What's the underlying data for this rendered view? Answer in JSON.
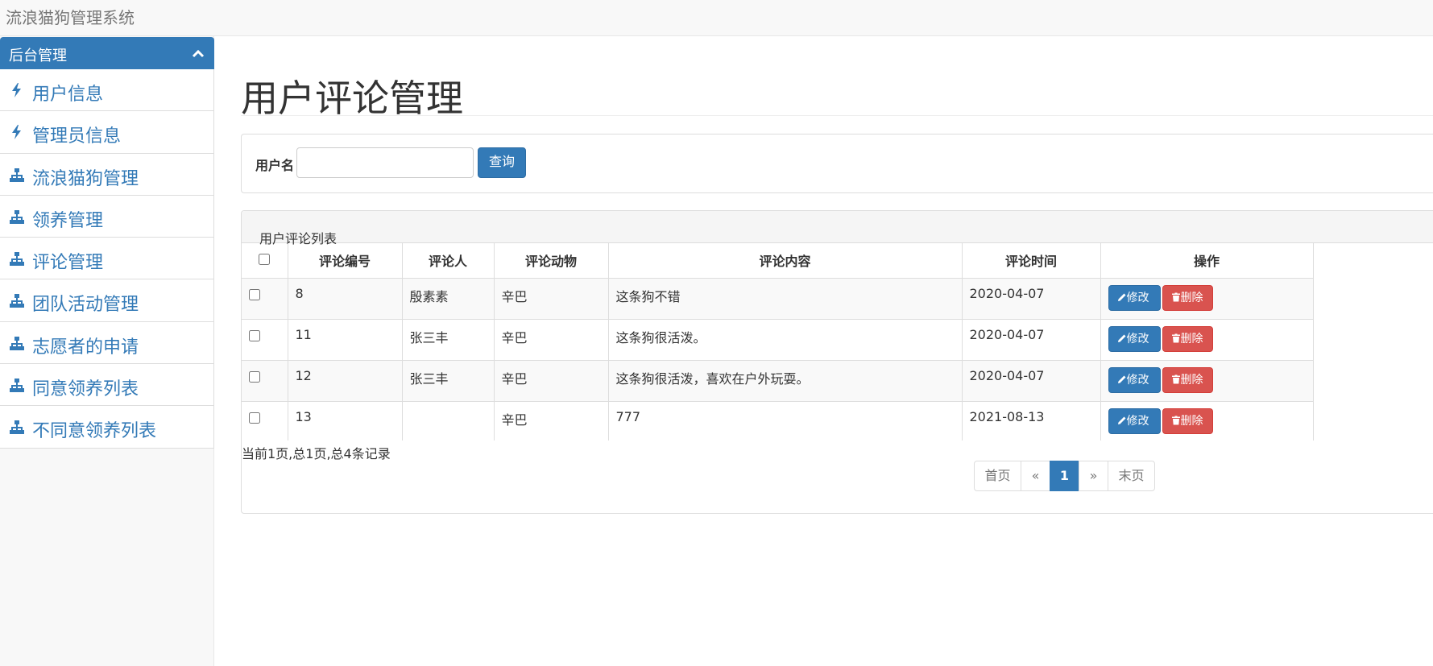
{
  "app": {
    "title": "流浪猫狗管理系统"
  },
  "sidebar": {
    "header": "后台管理",
    "items": [
      {
        "label": "用户信息",
        "icon": "bolt-icon"
      },
      {
        "label": "管理员信息",
        "icon": "bolt-icon"
      },
      {
        "label": "流浪猫狗管理",
        "icon": "sitemap-icon"
      },
      {
        "label": "领养管理",
        "icon": "sitemap-icon"
      },
      {
        "label": "评论管理",
        "icon": "sitemap-icon"
      },
      {
        "label": "团队活动管理",
        "icon": "sitemap-icon"
      },
      {
        "label": "志愿者的申请",
        "icon": "sitemap-icon"
      },
      {
        "label": "同意领养列表",
        "icon": "sitemap-icon"
      },
      {
        "label": "不同意领养列表",
        "icon": "sitemap-icon"
      }
    ]
  },
  "main": {
    "page_title": "用户评论管理",
    "search": {
      "label": "用户名",
      "value": "",
      "button": "查询"
    },
    "list": {
      "title": "用户评论列表",
      "columns": [
        "评论编号",
        "评论人",
        "评论动物",
        "评论内容",
        "评论时间",
        "操作"
      ],
      "rows": [
        {
          "id": "8",
          "user": "殷素素",
          "animal": "辛巴",
          "content": "这条狗不错",
          "time": "2020-04-07"
        },
        {
          "id": "11",
          "user": "张三丰",
          "animal": "辛巴",
          "content": "这条狗很活泼。",
          "time": "2020-04-07"
        },
        {
          "id": "12",
          "user": "张三丰",
          "animal": "辛巴",
          "content": "这条狗很活泼，喜欢在户外玩耍。",
          "time": "2020-04-07"
        },
        {
          "id": "13",
          "user": "",
          "animal": "辛巴",
          "content": "777",
          "time": "2021-08-13"
        }
      ],
      "edit_label": "修改",
      "delete_label": "删除"
    },
    "summary": "当前1页,总1页,总4条记录",
    "pagination": {
      "first": "首页",
      "prev": "«",
      "current": "1",
      "next": "»",
      "last": "末页"
    }
  },
  "colors": {
    "primary": "#337ab7",
    "danger": "#d9534f",
    "sidebar_bg": "#f8f8f8"
  }
}
